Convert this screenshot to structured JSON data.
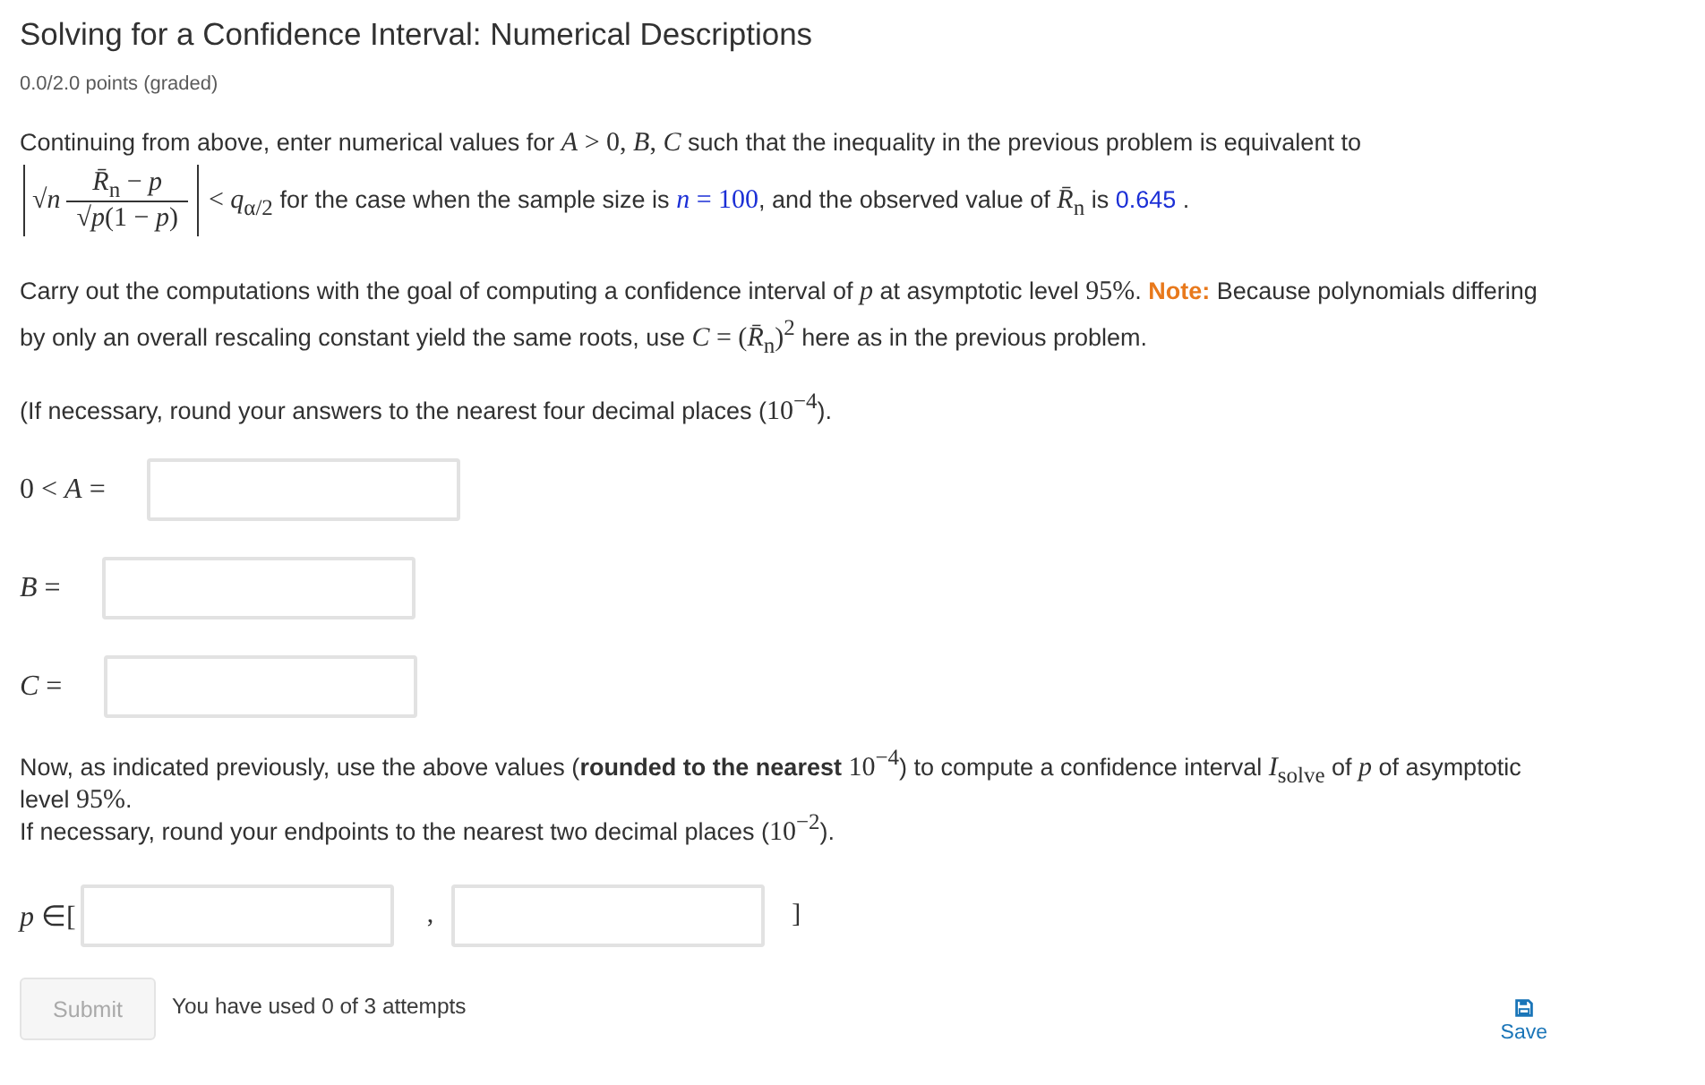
{
  "title": "Solving for a Confidence Interval: Numerical Descriptions",
  "score": "0.0/2.0 points (graded)",
  "intro": [
    {
      "kind": "text",
      "text": "Continuing from above, enter numerical values for "
    },
    {
      "kind": "math",
      "text": "*A* > 0, *B*, *C*"
    },
    {
      "kind": "text",
      "text": " such that the inequality in the previous problem is equivalent to"
    }
  ],
  "formula": {
    "factor": "√*n*",
    "numerator": "*R̄*$_{n}$ − *p*",
    "denominator": "√*p*(1 − *p*)"
  },
  "formula_tail": [
    {
      "kind": "math",
      "text": "< *q*$_{α/2}$"
    },
    {
      "kind": "text",
      "text": " for the case when the sample size is "
    },
    {
      "kind": "value",
      "text": "*n* = 100"
    },
    {
      "kind": "text",
      "text": ", and the observed value of "
    },
    {
      "kind": "math",
      "text": "*R̄*$_{n}$"
    },
    {
      "kind": "text",
      "text": " is "
    },
    {
      "kind": "number",
      "text": "0.645"
    },
    {
      "kind": "text",
      "text": " ."
    }
  ],
  "instructions": [
    {
      "kind": "text",
      "text": "Carry out the computations with the goal of computing a confidence interval of "
    },
    {
      "kind": "math",
      "text": "*p*"
    },
    {
      "kind": "text",
      "text": " at asymptotic level "
    },
    {
      "kind": "math",
      "text": "95%"
    },
    {
      "kind": "text",
      "text": ". "
    },
    {
      "kind": "note",
      "text": "Note:"
    },
    {
      "kind": "text",
      "text": " Because polynomials differing by only an overall rescaling constant yield the same roots, use "
    },
    {
      "kind": "math",
      "text": "*C* = (*R̄*$_{n}$)$^{2}$"
    },
    {
      "kind": "text",
      "text": " here as in the previous problem."
    }
  ],
  "rounding": [
    {
      "kind": "text",
      "text": "(If necessary, round your answers to the nearest four decimal places ("
    },
    {
      "kind": "math",
      "text": "10$^{−4}$"
    },
    {
      "kind": "text",
      "text": ")."
    }
  ],
  "answer_fields": [
    {
      "label": "0 < *A* ="
    },
    {
      "label": "*B* ="
    },
    {
      "label": "*C* ="
    }
  ],
  "interval_text": [
    {
      "kind": "text",
      "text": "Now, as indicated previously, use the above values ("
    },
    {
      "kind": "strong",
      "text": "rounded to the nearest"
    },
    {
      "kind": "math",
      "text": " 10$^{−4}$"
    },
    {
      "kind": "text",
      "text": ") to compute a confidence interval "
    },
    {
      "kind": "math",
      "text": "*I*$_{solve}$"
    },
    {
      "kind": "text",
      "text": " of "
    },
    {
      "kind": "math",
      "text": "*p*"
    },
    {
      "kind": "text",
      "text": " of asymptotic level "
    },
    {
      "kind": "math",
      "text": "95%"
    },
    {
      "kind": "text",
      "text": "."
    }
  ],
  "interval_rounding": [
    {
      "kind": "text",
      "text": "If necessary, round your endpoints to the nearest two decimal places ("
    },
    {
      "kind": "math",
      "text": "10$^{−2}$"
    },
    {
      "kind": "text",
      "text": ")."
    }
  ],
  "interval": {
    "prefix": "*p* ∈[",
    "separator": ",",
    "suffix": "]"
  },
  "submit": {
    "label": "Submit",
    "disabled": true
  },
  "attempts": "You have used 0 of 3 attempts",
  "save": {
    "label": "Save"
  }
}
